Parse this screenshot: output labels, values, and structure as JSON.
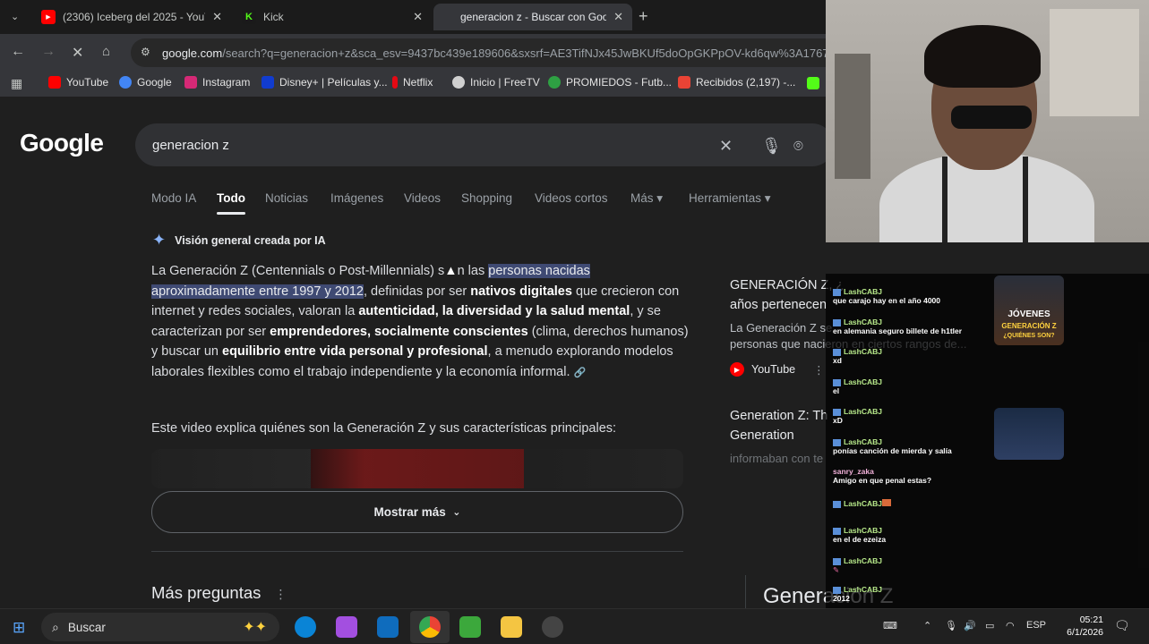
{
  "browser": {
    "tabs": [
      {
        "title": "(2306) Iceberg del 2025 - YouTu",
        "icon": "youtube-icon",
        "active": false
      },
      {
        "title": "Kick",
        "icon": "kick-icon",
        "active": false
      },
      {
        "title": "generacion z - Buscar con Goo",
        "icon": "google-icon",
        "active": true
      }
    ],
    "url_host": "google.com",
    "url_rest": "/search?q=generacion+z&sca_esv=9437bc439e189606&sxsrf=AE3TifNJx45JwBKUf5doOpGKPpOV-kd6qw%3A17676",
    "bookmarks": [
      "YouTube",
      "Google",
      "Instagram",
      "Disney+ | Películas y...",
      "Netflix",
      "Inicio | FreeTV",
      "PROMIEDOS - Futb...",
      "Recibidos (2,197) -..."
    ]
  },
  "search": {
    "logo": "Google",
    "query": "generacion z",
    "tabs": [
      "Modo IA",
      "Todo",
      "Noticias",
      "Imágenes",
      "Videos",
      "Shopping",
      "Videos cortos",
      "Más ▾",
      "Herramientas ▾"
    ]
  },
  "ai_overview": {
    "heading": "Visión general creada por IA",
    "p_1": "La Generación Z (Centennials o Post-Millennials) s",
    "p_2": "n las ",
    "p_hl": "personas nacidas aproximadamente entre 1997 y 2012",
    "p_3": ", definidas por ser ",
    "p_b1": "nativos digitales",
    "p_4": " que crecieron con internet y redes sociales, valoran la ",
    "p_b2": "autenticidad, la diversidad y la salud mental",
    "p_5": ", y se caracterizan por ser ",
    "p_b3": "emprendedores, socialmente conscientes",
    "p_6": " (clima, derechos humanos) y buscar un ",
    "p_b4": "equilibrio entre vida personal y profesional",
    "p_7": ", a menudo explorando modelos laborales flexibles como el trabajo independiente y la economía informal.",
    "video_line": "Este video explica quiénes son la Generación Z y sus características principales:",
    "show_more": "Mostrar más",
    "more_questions": "Más preguntas"
  },
  "side_results": {
    "r1_title_a": "GENERACIÓN Z, ¿",
    "r1_title_b": "años pertenecen",
    "r1_snip_a": "La Generación Z se",
    "r1_snip_b": "personas que nacieron en ciertos rangos de...",
    "source": "YouTube",
    "r2_title_a": "Generation Z: Th",
    "r2_title_b": "Generation",
    "r2_snip": "informaban con te",
    "bottom_label": "Generación Z"
  },
  "chat": {
    "messages": [
      {
        "user": "LashCABJ",
        "text": "que carajo hay en el año 4000"
      },
      {
        "user": "LashCABJ",
        "text": "en alemania seguro billete de h1tler"
      },
      {
        "user": "LashCABJ",
        "text": "xd"
      },
      {
        "user": "LashCABJ",
        "text": "el"
      },
      {
        "user": "LashCABJ",
        "text": "xD"
      },
      {
        "user": "LashCABJ",
        "text": "ponías canción de mierda y salía"
      },
      {
        "user": "sanry_zaka",
        "text": "Amigo en que penal estas?"
      },
      {
        "user": "LashCABJ",
        "text": ""
      },
      {
        "user": "LashCABJ",
        "text": "en el de ezeiza"
      },
      {
        "user": "LashCABJ",
        "text": ""
      },
      {
        "user": "LashCABJ",
        "text": "2012"
      }
    ],
    "thumb_text_1": "JÓVENES",
    "thumb_text_2": "GENERACIÓN Z",
    "thumb_text_3": "¿QUIÉNES SON?",
    "bottom_text": "ucción Z"
  },
  "taskbar": {
    "search": "Buscar",
    "lang": "ESP",
    "time": "05:21",
    "date": "6/1/2026"
  }
}
